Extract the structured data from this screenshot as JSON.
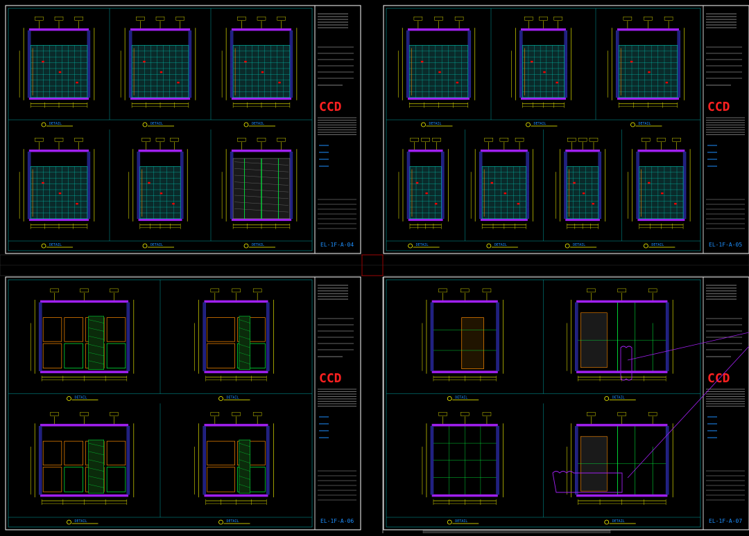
{
  "colors": {
    "background": "#000000",
    "sheet_border": "#ffffff",
    "frame": "#00a0a0",
    "wall": "#a020f0",
    "dim": "#ffff00",
    "tile": "#00c8b4",
    "accent_red": "#ff0000",
    "accent_orange": "#ff8c00",
    "accent_green": "#00ff40",
    "brand": "#ff2020",
    "title_blue": "#1e90ff"
  },
  "brand_text": "CCD",
  "sheets": [
    {
      "sheet_no": "EL-1F-A-04"
    },
    {
      "sheet_no": "EL-1F-A-05"
    },
    {
      "sheet_no": "EL-1F-A-06"
    },
    {
      "sheet_no": "EL-1F-A-07"
    }
  ],
  "detail_label": "DETAIL"
}
